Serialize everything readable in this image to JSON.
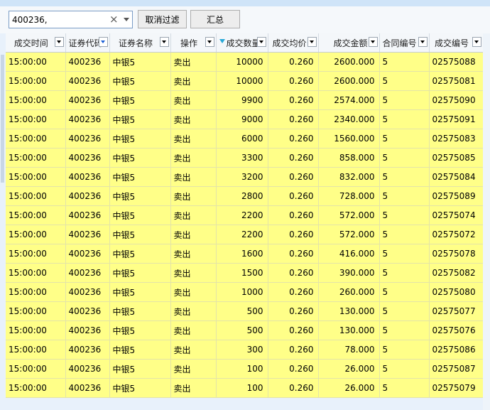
{
  "filter": {
    "value": "400236,",
    "clear_icon": "×"
  },
  "buttons": {
    "cancel_filter": "取消过滤",
    "summary": "汇总"
  },
  "columns": [
    {
      "label": "成交时间",
      "align": "center"
    },
    {
      "label": "证券代码",
      "align": "left"
    },
    {
      "label": "证券名称",
      "align": "center"
    },
    {
      "label": "操作",
      "align": "center"
    },
    {
      "label": "成交数量",
      "align": "left",
      "sorted": true
    },
    {
      "label": "成交均价",
      "align": "right"
    },
    {
      "label": "成交金额",
      "align": "right"
    },
    {
      "label": "合同编号",
      "align": "left"
    },
    {
      "label": "成交编号",
      "align": "center"
    }
  ],
  "rows": [
    [
      "15:00:00",
      "400236",
      "中银5",
      "卖出",
      "10000",
      "0.260",
      "2600.000",
      "5",
      "02575088"
    ],
    [
      "15:00:00",
      "400236",
      "中银5",
      "卖出",
      "10000",
      "0.260",
      "2600.000",
      "5",
      "02575081"
    ],
    [
      "15:00:00",
      "400236",
      "中银5",
      "卖出",
      "9900",
      "0.260",
      "2574.000",
      "5",
      "02575090"
    ],
    [
      "15:00:00",
      "400236",
      "中银5",
      "卖出",
      "9000",
      "0.260",
      "2340.000",
      "5",
      "02575091"
    ],
    [
      "15:00:00",
      "400236",
      "中银5",
      "卖出",
      "6000",
      "0.260",
      "1560.000",
      "5",
      "02575083"
    ],
    [
      "15:00:00",
      "400236",
      "中银5",
      "卖出",
      "3300",
      "0.260",
      "858.000",
      "5",
      "02575085"
    ],
    [
      "15:00:00",
      "400236",
      "中银5",
      "卖出",
      "3200",
      "0.260",
      "832.000",
      "5",
      "02575084"
    ],
    [
      "15:00:00",
      "400236",
      "中银5",
      "卖出",
      "2800",
      "0.260",
      "728.000",
      "5",
      "02575089"
    ],
    [
      "15:00:00",
      "400236",
      "中银5",
      "卖出",
      "2200",
      "0.260",
      "572.000",
      "5",
      "02575074"
    ],
    [
      "15:00:00",
      "400236",
      "中银5",
      "卖出",
      "2200",
      "0.260",
      "572.000",
      "5",
      "02575072"
    ],
    [
      "15:00:00",
      "400236",
      "中银5",
      "卖出",
      "1600",
      "0.260",
      "416.000",
      "5",
      "02575078"
    ],
    [
      "15:00:00",
      "400236",
      "中银5",
      "卖出",
      "1500",
      "0.260",
      "390.000",
      "5",
      "02575082"
    ],
    [
      "15:00:00",
      "400236",
      "中银5",
      "卖出",
      "1000",
      "0.260",
      "260.000",
      "5",
      "02575080"
    ],
    [
      "15:00:00",
      "400236",
      "中银5",
      "卖出",
      "500",
      "0.260",
      "130.000",
      "5",
      "02575077"
    ],
    [
      "15:00:00",
      "400236",
      "中银5",
      "卖出",
      "500",
      "0.260",
      "130.000",
      "5",
      "02575076"
    ],
    [
      "15:00:00",
      "400236",
      "中银5",
      "卖出",
      "300",
      "0.260",
      "78.000",
      "5",
      "02575086"
    ],
    [
      "15:00:00",
      "400236",
      "中银5",
      "卖出",
      "100",
      "0.260",
      "26.000",
      "5",
      "02575087"
    ],
    [
      "15:00:00",
      "400236",
      "中银5",
      "卖出",
      "100",
      "0.260",
      "26.000",
      "5",
      "02575079"
    ]
  ],
  "colors": {
    "row_background": "#ffff88",
    "header_background": "#f4f7fa"
  }
}
